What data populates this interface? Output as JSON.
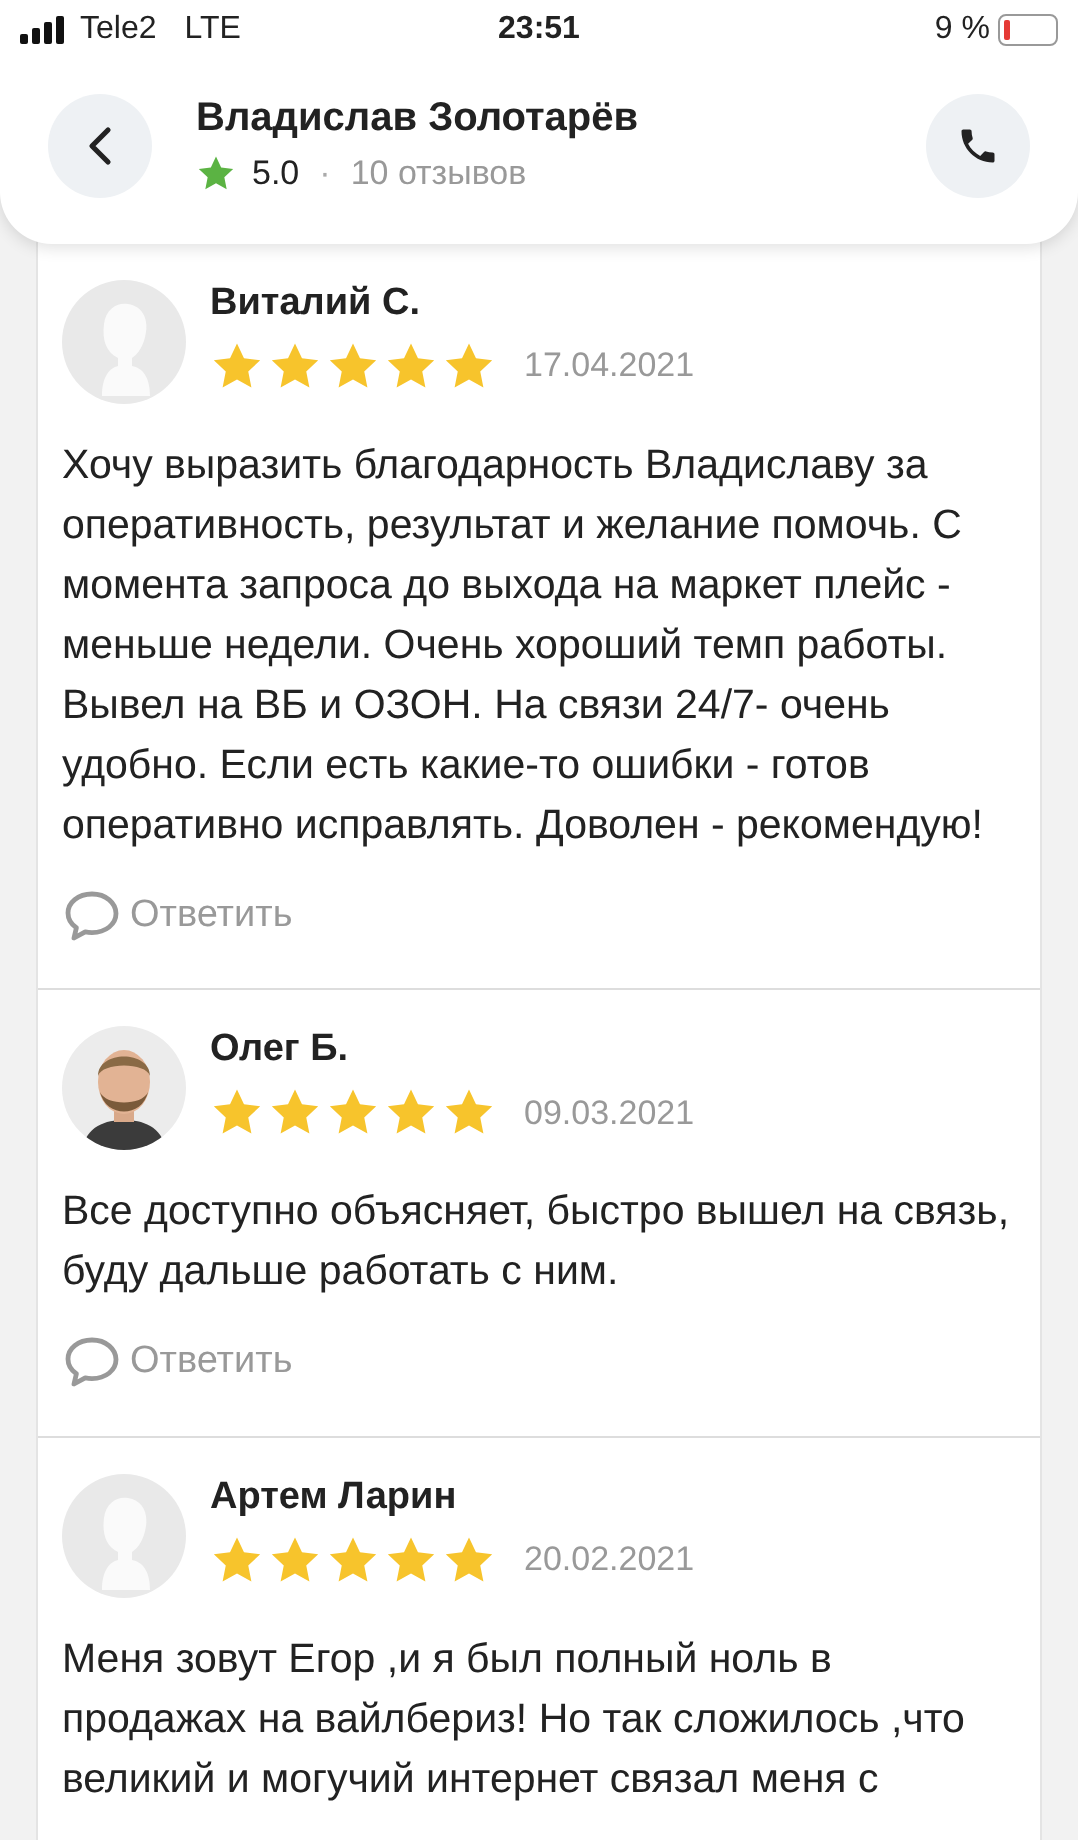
{
  "status_bar": {
    "carrier": "Tele2",
    "network": "LTE",
    "time": "23:51",
    "battery_text": "9 %"
  },
  "header": {
    "title": "Владислав Золотарёв",
    "rating": "5.0",
    "separator": "·",
    "reviews_count": "10 отзывов"
  },
  "reviews": [
    {
      "author": "Виталий С.",
      "kind": "default",
      "stars": 5,
      "date": "17.04.2021",
      "text": "Хочу выразить благодарность Владиславу за оперативность, результат и желание помочь. С момента запроса до выхода на маркет плейс - меньше недели. Очень хороший темп работы. Вывел на ВБ и ОЗОН. На связи 24/7- очень удобно. Если есть какие-то ошибки - готов оперативно исправлять. Доволен - рекомендую!",
      "reply": "Ответить"
    },
    {
      "author": "Олег Б.",
      "stars": 5,
      "date": "09.03.2021",
      "text": "Все доступно объясняет, быстро вышел на связь, буду дальше работать с ним.",
      "reply": "Ответить"
    },
    {
      "author": "Артем Ларин",
      "kind": "default",
      "stars": 5,
      "date": "20.02.2021",
      "text": "Меня зовут Егор ,и я был полный ноль в продажах на вайлбериз! Но так сложилось ,что великий и могучий интернет связал меня с"
    }
  ]
}
